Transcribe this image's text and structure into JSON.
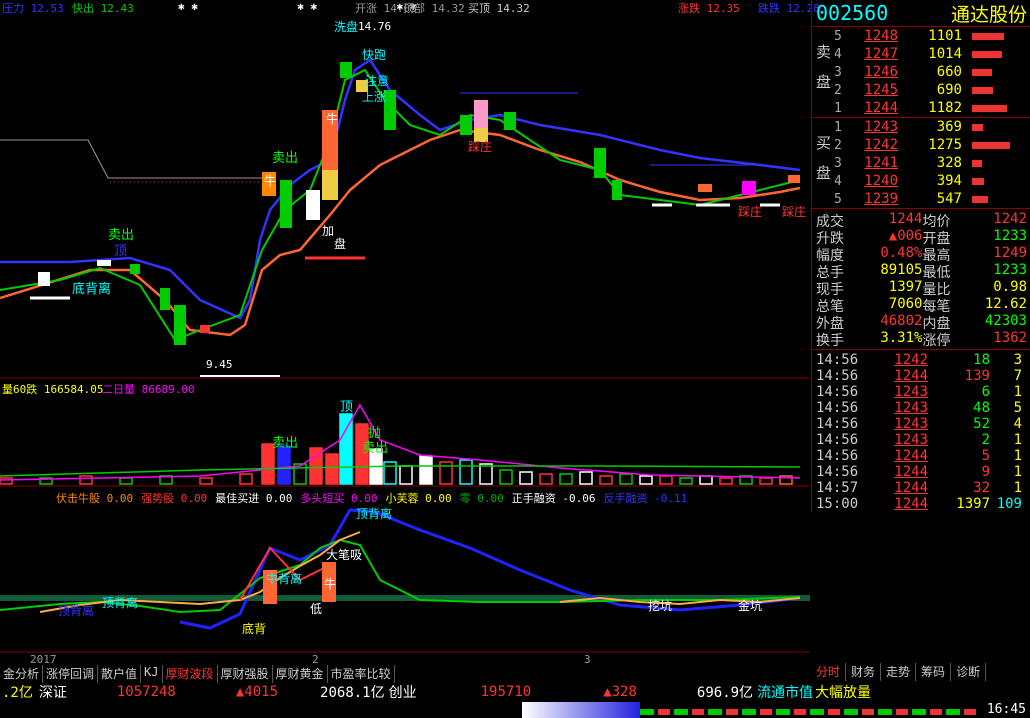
{
  "top_bar": {
    "pressure": "压力 12.53",
    "fast_out": "快出 12.43",
    "right_a": "涨跌 12.35",
    "right_b": "跌跌 12.28",
    "center_a": "开涨 14.05",
    "center_b": "顶部 14.32",
    "center_c": "买顶 14.32"
  },
  "price_annotations": {
    "high": "14.76",
    "low": "9.45",
    "sell1": "卖出",
    "sell2": "卖出",
    "top": "顶",
    "bottom_div": "底背离",
    "bull": "牛",
    "add": "加",
    "hold": "盘",
    "wash": "洗盘",
    "quick_run": "快跑",
    "note": "注意",
    "up_rise": "上涨",
    "step_pit": "踩庄",
    "step_pit2": "踩庄",
    "step_pit3": "踩庄"
  },
  "volume_header": {
    "a": "量60跌 166584.05",
    "b": "二日量 86689.00"
  },
  "volume_annotations": {
    "top": "顶",
    "sell": "卖出",
    "pull": "抛",
    "sell2": "卖出"
  },
  "indicator_header": [
    {
      "label": "伏击牛股 0.00",
      "color": "#f80"
    },
    {
      "label": "强势股 0.00",
      "color": "#f33"
    },
    {
      "label": "最佳买进 0.00",
      "color": "#fff"
    },
    {
      "label": "多头短买 0.00",
      "color": "#f0f"
    },
    {
      "label": "小芙蓉 0.00",
      "color": "#ff0"
    },
    {
      "label": "零 0.00",
      "color": "#0a0"
    },
    {
      "label": "正手融资 -0.06",
      "color": "#fff"
    },
    {
      "label": "反手融资 -0.11",
      "color": "#33f"
    }
  ],
  "indicator_annotations": {
    "top_div": "顶背离",
    "big": "大笔吸",
    "mid": "中背离",
    "bull": "牛",
    "low": "低",
    "bottom": "底背",
    "top_div2": "顶背离",
    "top_div3": "顶背离",
    "dig": "挖坑",
    "gold": "金坑"
  },
  "axis": {
    "year": "2017",
    "m2": "2",
    "m3": "3"
  },
  "stock": {
    "code": "002560",
    "name": "通达股份"
  },
  "order_book": {
    "sell_label": [
      "卖",
      "盘"
    ],
    "buy_label": [
      "买",
      "盘"
    ],
    "sell": [
      {
        "n": "5",
        "price": "1248",
        "vol": "1101",
        "bar": 0.85
      },
      {
        "n": "4",
        "price": "1247",
        "vol": "1014",
        "bar": 0.8
      },
      {
        "n": "3",
        "price": "1246",
        "vol": "660",
        "bar": 0.52
      },
      {
        "n": "2",
        "price": "1245",
        "vol": "690",
        "bar": 0.55
      },
      {
        "n": "1",
        "price": "1244",
        "vol": "1182",
        "bar": 0.93
      }
    ],
    "buy": [
      {
        "n": "1",
        "price": "1243",
        "vol": "369",
        "bar": 0.3
      },
      {
        "n": "2",
        "price": "1242",
        "vol": "1275",
        "bar": 1.0
      },
      {
        "n": "3",
        "price": "1241",
        "vol": "328",
        "bar": 0.26
      },
      {
        "n": "4",
        "price": "1240",
        "vol": "394",
        "bar": 0.31
      },
      {
        "n": "5",
        "price": "1239",
        "vol": "547",
        "bar": 0.43
      }
    ]
  },
  "stats": [
    {
      "k": "成交",
      "v": "1244",
      "vc": "red",
      "k2": "均价",
      "v2": "1242",
      "v2c": "red"
    },
    {
      "k": "升跌",
      "v": "▲006",
      "vc": "red",
      "k2": "开盘",
      "v2": "1233",
      "v2c": "green"
    },
    {
      "k": "幅度",
      "v": "0.48%",
      "vc": "red",
      "k2": "最高",
      "v2": "1249",
      "v2c": "red"
    },
    {
      "k": "总手",
      "v": "89105",
      "vc": "yellow",
      "k2": "最低",
      "v2": "1233",
      "v2c": "green"
    },
    {
      "k": "现手",
      "v": "1397",
      "vc": "yellow",
      "k2": "量比",
      "v2": "0.98",
      "v2c": "yellow"
    },
    {
      "k": "总笔",
      "v": "7060",
      "vc": "yellow",
      "k2": "每笔",
      "v2": "12.62",
      "v2c": "yellow"
    },
    {
      "k": "外盘",
      "v": "46802",
      "vc": "red",
      "k2": "内盘",
      "v2": "42303",
      "v2c": "green"
    },
    {
      "k": "换手",
      "v": "3.31%",
      "vc": "yellow",
      "k2": "涨停",
      "v2": "1362",
      "v2c": "red"
    }
  ],
  "ticks": [
    {
      "t": "14:56",
      "p": "1242",
      "v": "18",
      "n": "3",
      "vc": "green",
      "nc": "yellow"
    },
    {
      "t": "14:56",
      "p": "1244",
      "v": "139",
      "n": "7",
      "vc": "red",
      "nc": "yellow"
    },
    {
      "t": "14:56",
      "p": "1243",
      "v": "6",
      "n": "1",
      "vc": "green",
      "nc": "yellow"
    },
    {
      "t": "14:56",
      "p": "1243",
      "v": "48",
      "n": "5",
      "vc": "green",
      "nc": "yellow"
    },
    {
      "t": "14:56",
      "p": "1243",
      "v": "52",
      "n": "4",
      "vc": "green",
      "nc": "yellow"
    },
    {
      "t": "14:56",
      "p": "1243",
      "v": "2",
      "n": "1",
      "vc": "green",
      "nc": "yellow"
    },
    {
      "t": "14:56",
      "p": "1244",
      "v": "5",
      "n": "1",
      "vc": "red",
      "nc": "yellow"
    },
    {
      "t": "14:56",
      "p": "1244",
      "v": "9",
      "n": "1",
      "vc": "red",
      "nc": "yellow"
    },
    {
      "t": "14:57",
      "p": "1244",
      "v": "32",
      "n": "1",
      "vc": "red",
      "nc": "yellow"
    },
    {
      "t": "15:00",
      "p": "1244",
      "v": "1397",
      "n": "109",
      "vc": "yellow",
      "nc": "cyan"
    }
  ],
  "tabs": [
    "金分析",
    "涨停回调",
    "散户值",
    "KJ",
    "厚财波段",
    "厚财强股",
    "厚财黄金",
    "市盈率比较"
  ],
  "active_tab": "厚财波段",
  "right_tabs": [
    "分时",
    "财务",
    "走势",
    "筹码",
    "诊断"
  ],
  "status": {
    "a": ".2亿",
    "b": "深证",
    "c": "1057248",
    "d": "▲4015",
    "e": "2068.1亿",
    "f": "创业",
    "g": "195710",
    "h": "▲328",
    "i": "696.9亿",
    "j": "流通市值",
    "k": "大幅放量",
    "time": "16:45"
  },
  "colors": {
    "up": "#f33",
    "down": "#0f0",
    "accent": "#0ff",
    "bg": "#000"
  }
}
